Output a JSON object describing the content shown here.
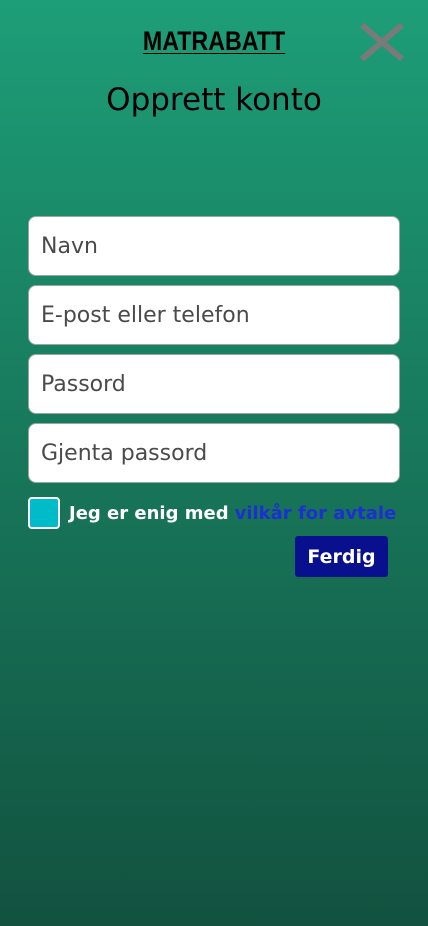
{
  "header": {
    "logo_text": "MATRABATT",
    "close_icon": "close-icon",
    "title": "Opprett konto"
  },
  "form": {
    "name_placeholder": "Navn",
    "contact_placeholder": "E-post eller telefon",
    "password_placeholder": "Passord",
    "repeat_password_placeholder": "Gjenta passord",
    "agree_text": "Jeg er enig med",
    "terms_link": "vilkår for avtale",
    "submit_label": "Ferdig"
  },
  "colors": {
    "background_top": "#1d9e78",
    "background_bottom": "#12523f",
    "checkbox": "#00bcc9",
    "link": "#1c2fd1",
    "button": "#08108e",
    "close_icon": "#7a7a7a"
  }
}
